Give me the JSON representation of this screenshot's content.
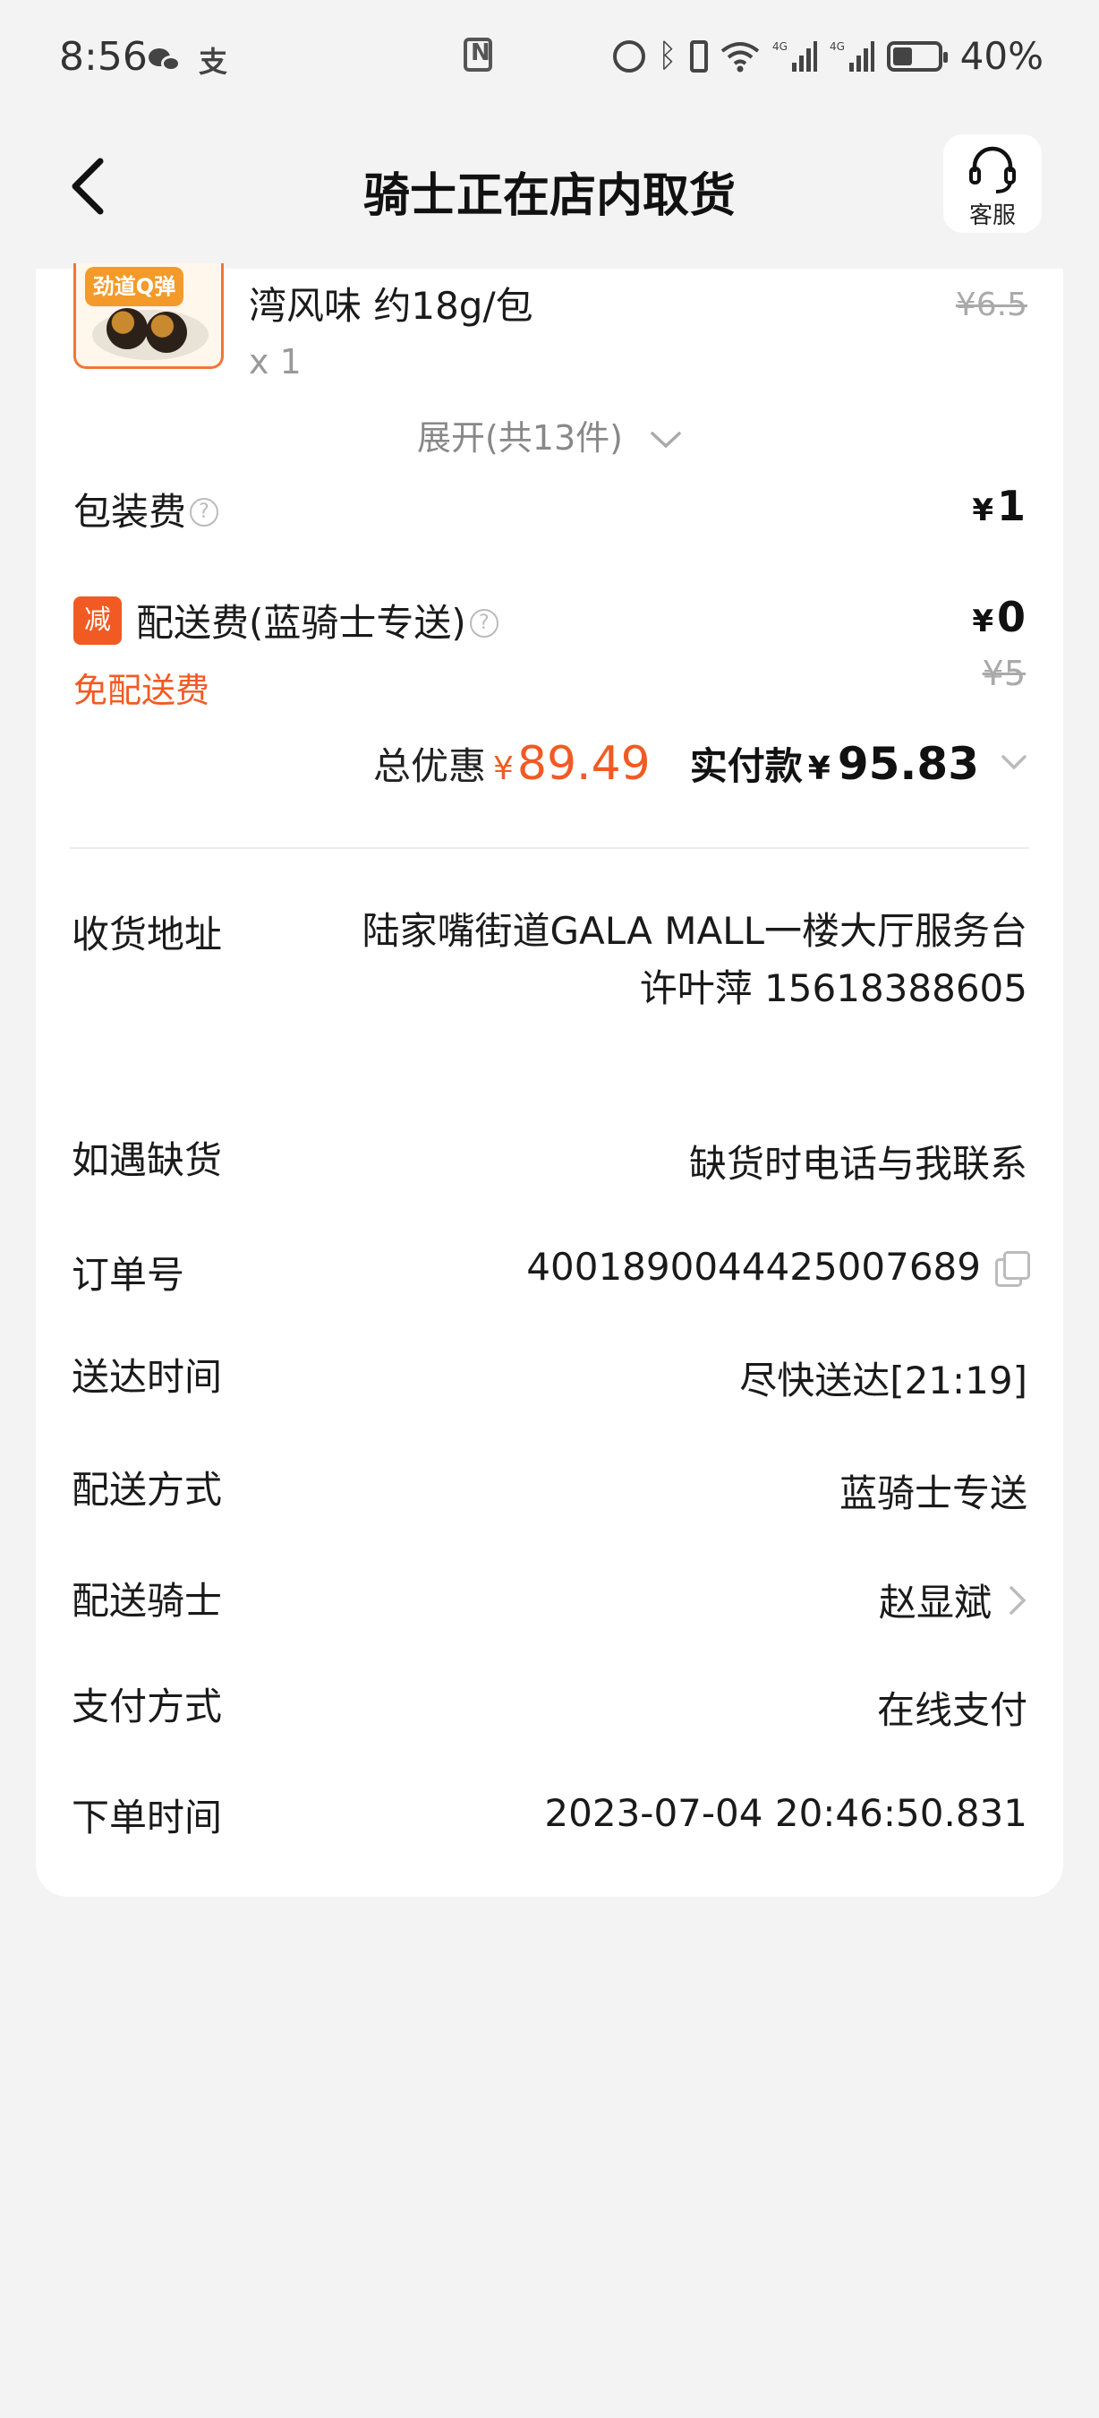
{
  "status_bar": {
    "time": "8:56",
    "alipay_glyph": "支",
    "network_label": "4G",
    "battery": "40%",
    "battery_level": 0.4,
    "icons": [
      "wechat-icon",
      "alipay-icon",
      "nfc-icon",
      "alarm-icon",
      "bluetooth-icon",
      "vibrate-icon",
      "wifi-icon",
      "signal-icon",
      "battery-icon"
    ]
  },
  "header": {
    "title": "骑士正在店内取货",
    "service_label": "客服"
  },
  "order": {
    "product": {
      "badge": "劲道Q弹",
      "name": "湾风味 约18g/包",
      "quantity": "x 1",
      "original_price": "¥6.5"
    },
    "expand_label": "展开(共13件)",
    "packaging": {
      "label": "包装费",
      "currency": "¥",
      "price": "1"
    },
    "delivery": {
      "badge": "减",
      "label": "配送费(蓝骑士专送)",
      "currency": "¥",
      "price": "0",
      "original_price": "¥5",
      "free_note": "免配送费"
    },
    "summary": {
      "discount_label": "总优惠",
      "currency": "¥",
      "discount_value": "89.49",
      "paid_label": "实付款",
      "paid_value": "95.83"
    }
  },
  "info": {
    "address": {
      "label": "收货地址",
      "line1": "陆家嘴街道GALA MALL一楼大厅服务台",
      "line2": "许叶萍 15618388605"
    },
    "out_of_stock": {
      "label": "如遇缺货",
      "value": "缺货时电话与我联系"
    },
    "order_no": {
      "label": "订单号",
      "value": "4001890044425007689"
    },
    "delivery_time": {
      "label": "送达时间",
      "value": "尽快送达[21:19]"
    },
    "delivery_method": {
      "label": "配送方式",
      "value": "蓝骑士专送"
    },
    "rider": {
      "label": "配送骑士",
      "value": "赵显斌"
    },
    "payment": {
      "label": "支付方式",
      "value": "在线支付"
    },
    "order_time": {
      "label": "下单时间",
      "value": "2023-07-04 20:46:50.831"
    }
  },
  "colors": {
    "accent": "#f25a24",
    "page_bg": "#f3f3f3",
    "card_bg": "#ffffff",
    "muted_text": "#999999"
  }
}
